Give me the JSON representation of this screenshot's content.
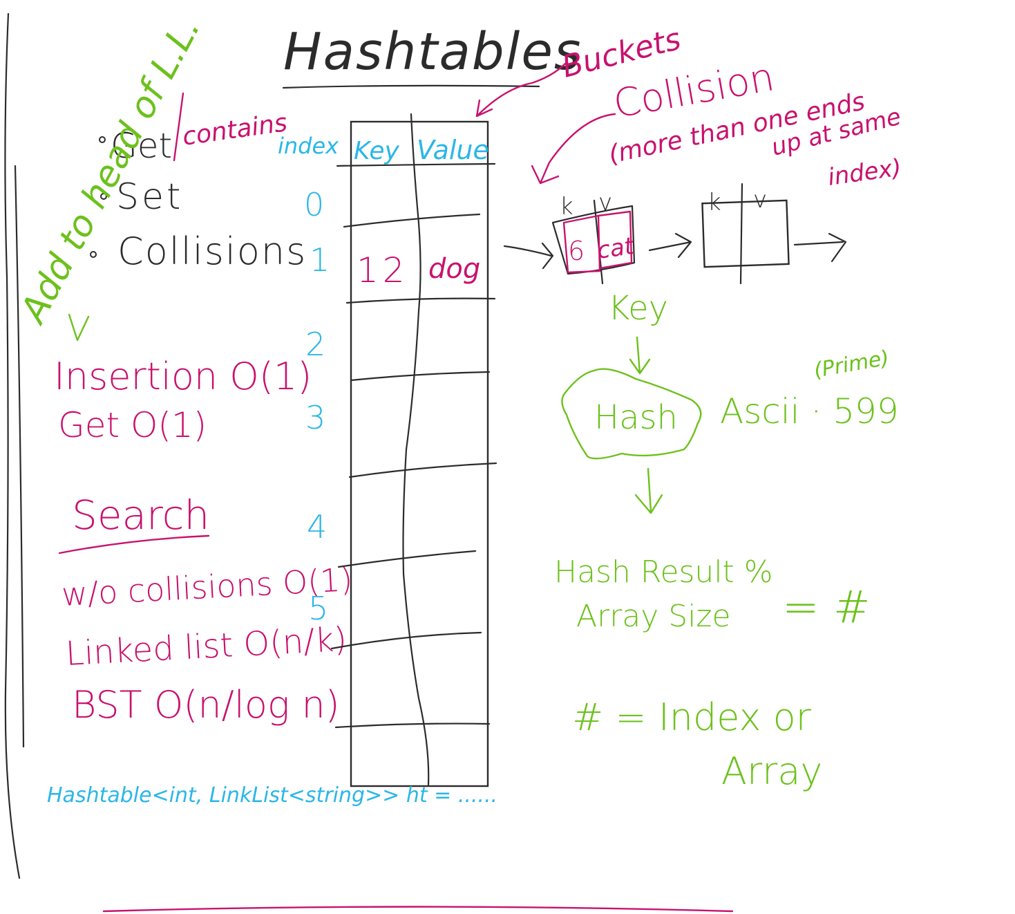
{
  "colors": {
    "black": "#2b2b2b",
    "pink": "#c8126e",
    "green": "#6cc11c",
    "blue": "#2bb6e8",
    "background": "#ffffff"
  },
  "title": "Hashtables",
  "topics": {
    "get": "Get",
    "contains": "contains",
    "set": "Set",
    "collisions": "Collisions"
  },
  "side_note": "Add to head of L.L.",
  "complexity": {
    "insertion": "Insertion O(1)",
    "get": "Get O(1)"
  },
  "search": {
    "heading": "Search",
    "no_collisions": "w/o collisions O(1)",
    "linked_list": "Linked list O(n/k)",
    "bst": "BST O(n/log n)"
  },
  "table": {
    "index_header": "index",
    "key_header": "Key",
    "value_header": "Value",
    "indices": [
      "0",
      "1",
      "2",
      "3",
      "4",
      "5"
    ],
    "row1_key": "12",
    "row1_value": "dog"
  },
  "buckets_label": "Buckets",
  "collision": {
    "heading": "Collision",
    "note_line1": "(more than one ends",
    "note_line2": "up at same",
    "note_line3": "index)"
  },
  "chain": {
    "k_label": "k",
    "v_label": "v",
    "node1_key": "6",
    "node1_value": "cat"
  },
  "hash_flow": {
    "key_label": "Key",
    "hash_label": "Hash",
    "ascii_label": "Ascii · 599",
    "prime_label": "(Prime)",
    "result_line1": "Hash Result %",
    "result_line2": "Array Size",
    "result_eq": "= #",
    "index_line1": "# = Index or",
    "index_line2": "Array"
  },
  "code_line": "Hashtable<int, LinkList<string>> ht = ......"
}
